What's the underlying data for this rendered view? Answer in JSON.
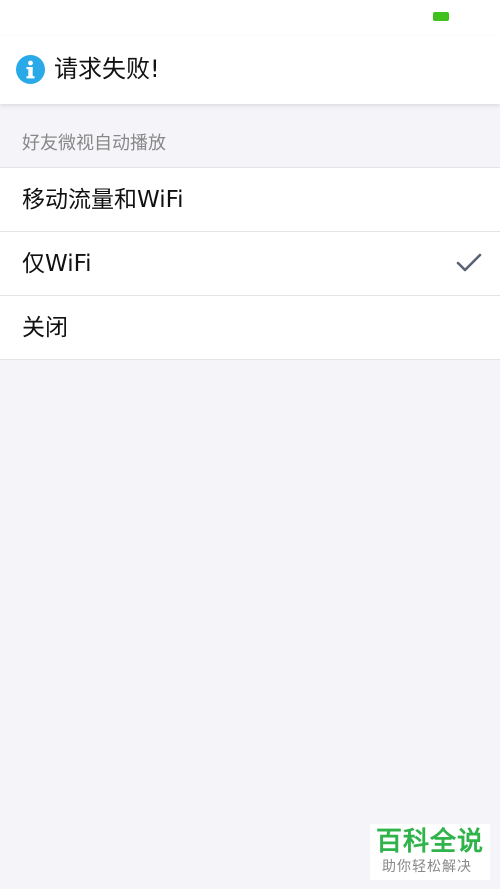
{
  "status_bar": {
    "battery_color": "#3ec11c"
  },
  "toast": {
    "icon": "info-icon",
    "icon_color": "#29a9e8",
    "message": "请求失败!"
  },
  "section": {
    "header": "好友微视自动播放"
  },
  "options": [
    {
      "label": "移动流量和WiFi",
      "selected": false
    },
    {
      "label": "仅WiFi",
      "selected": true
    },
    {
      "label": "关闭",
      "selected": false
    }
  ],
  "check_icon": "checkmark-icon",
  "watermark": {
    "title": "百科全说",
    "subtitle": "助你轻松解决",
    "color": "#2fb34a"
  }
}
